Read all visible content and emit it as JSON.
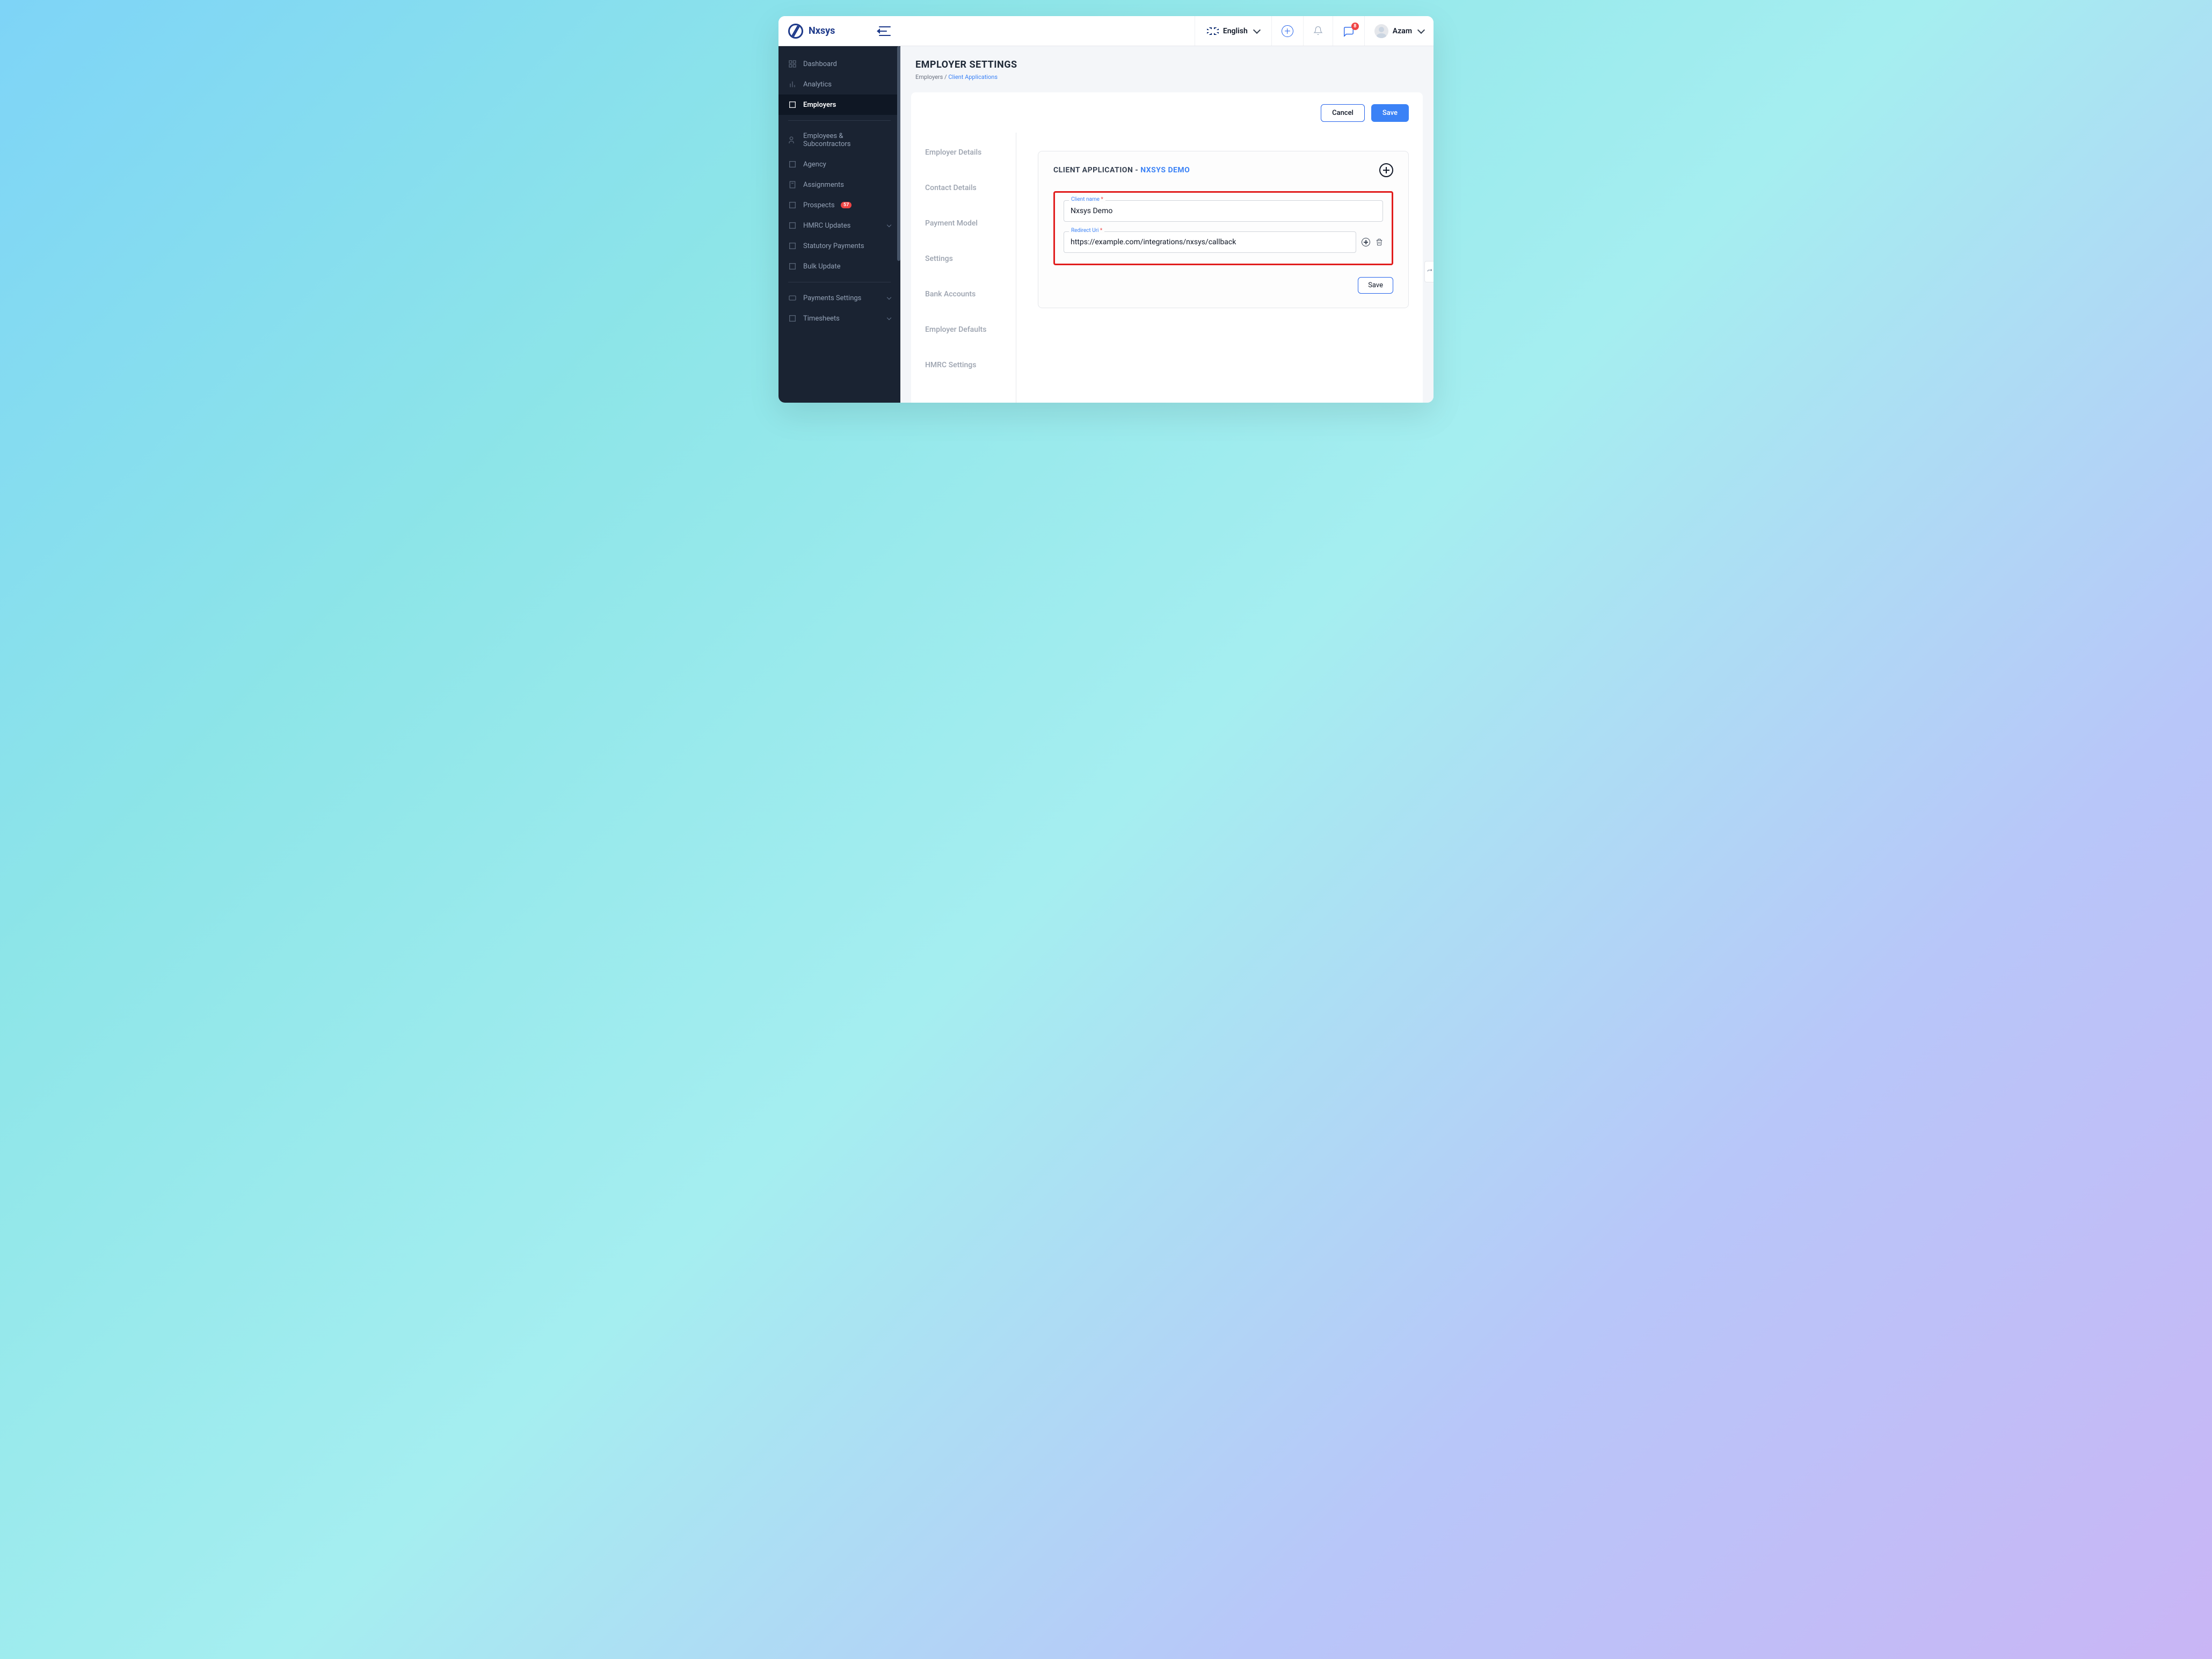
{
  "brand": "Nxsys",
  "header": {
    "language": "English",
    "notifications_count": "8",
    "user_name": "Azam"
  },
  "sidebar": {
    "items": [
      {
        "label": "Dashboard"
      },
      {
        "label": "Analytics"
      },
      {
        "label": "Employers"
      },
      {
        "label": "Employees & Subcontractors"
      },
      {
        "label": "Agency"
      },
      {
        "label": "Assignments"
      },
      {
        "label": "Prospects"
      },
      {
        "label": "HMRC Updates"
      },
      {
        "label": "Statutory Payments"
      },
      {
        "label": "Bulk Update"
      },
      {
        "label": "Payments Settings"
      },
      {
        "label": "Timesheets"
      }
    ],
    "prospects_badge": "57"
  },
  "page": {
    "title": "EMPLOYER SETTINGS",
    "breadcrumb_parent": "Employers",
    "breadcrumb_sep": " / ",
    "breadcrumb_current": "Client Applications",
    "cancel": "Cancel",
    "save": "Save"
  },
  "tabs": [
    "Employer Details",
    "Contact Details",
    "Payment Model",
    "Settings",
    "Bank Accounts",
    "Employer Defaults",
    "HMRC Settings"
  ],
  "card": {
    "title_prefix": "CLIENT APPLICATION - ",
    "title_name": "NXSYS DEMO",
    "client_name_label": "Client name",
    "client_name_value": "Nxsys Demo",
    "redirect_uri_label": "Redirect Uri",
    "redirect_uri_value": "https://example.com/integrations/nxsys/callback",
    "save": "Save"
  }
}
